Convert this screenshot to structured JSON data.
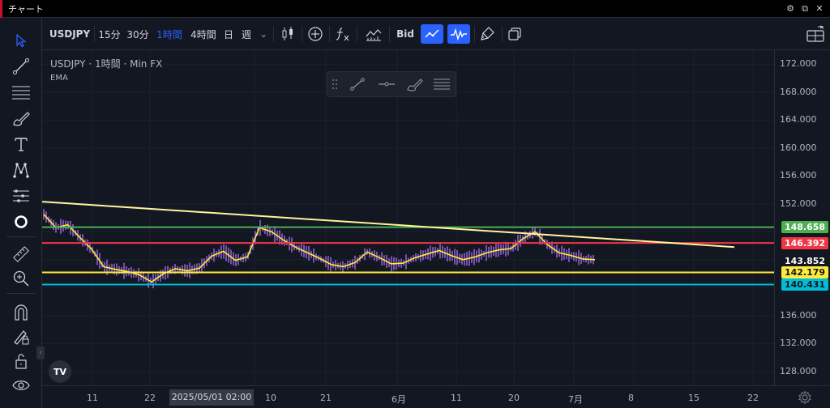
{
  "window": {
    "title": "チャート",
    "buttons": [
      {
        "name": "settings-icon",
        "glyph": "⚙"
      },
      {
        "name": "popout-icon",
        "glyph": "⧉"
      },
      {
        "name": "close-icon",
        "glyph": "✕"
      }
    ]
  },
  "toolbar": {
    "symbol": "USDJPY",
    "intervals": [
      "15分",
      "30分",
      "1時間",
      "4時間",
      "日",
      "週"
    ],
    "active_interval": "1時間",
    "bid_label": "Bid",
    "dropdown_glyph": "⌄"
  },
  "legend": {
    "symbol": "USDJPY",
    "interval": "1時間",
    "source": "Min FX",
    "separator": "·",
    "indicator": "EMA"
  },
  "colors": {
    "background": "#131722",
    "accent": "#2962ff",
    "green_line": "#4caf50",
    "red_line": "#f23645",
    "yellow_line": "#ffeb3b",
    "cyan_line": "#00bcd4",
    "trend_line": "#fff59d",
    "ema": "#ffeb3b",
    "candles": "#9c6ade"
  },
  "price_axis": {
    "ticks": [
      "172.000",
      "168.000",
      "164.000",
      "160.000",
      "156.000",
      "152.000",
      "136.000",
      "132.000",
      "128.000"
    ],
    "labels": [
      {
        "value": "148.658",
        "kind": "green"
      },
      {
        "value": "146.392",
        "kind": "red"
      },
      {
        "value": "143.852",
        "kind": "last"
      },
      {
        "value": "142.179",
        "kind": "yellow"
      },
      {
        "value": "140.431",
        "kind": "cyan"
      }
    ]
  },
  "time_axis": {
    "ticks": [
      "11",
      "22",
      "10",
      "21",
      "6月",
      "11",
      "20",
      "7月",
      "8",
      "15",
      "22"
    ],
    "crosshair_label": "2025/05/01   02:00"
  },
  "chart_data": {
    "type": "line",
    "series": [
      {
        "values": [
          150.5,
          148.6,
          149.0,
          147.2,
          145.5,
          143.0,
          142.6,
          142.3,
          141.8,
          140.8,
          142.0,
          142.7,
          142.4,
          142.8,
          144.5,
          145.2,
          143.9,
          144.4,
          148.6,
          148.0,
          146.8,
          145.8,
          145.0,
          144.2,
          143.3,
          143.0,
          143.6,
          145.1,
          144.3,
          143.4,
          143.5,
          144.3,
          144.8,
          145.3,
          144.6,
          144.0,
          144.4,
          145.0,
          145.4,
          145.6,
          147.0,
          148.0,
          146.2,
          145.0,
          144.6,
          144.1,
          144.0
        ]
      }
    ],
    "horizontal_levels": [
      148.658,
      146.392,
      142.179,
      140.431
    ],
    "trend_line": {
      "start_price": 152.3,
      "end_price": 145.8
    },
    "last_price": 143.852,
    "ylim": [
      126.0,
      174.0
    ],
    "grid": true
  }
}
